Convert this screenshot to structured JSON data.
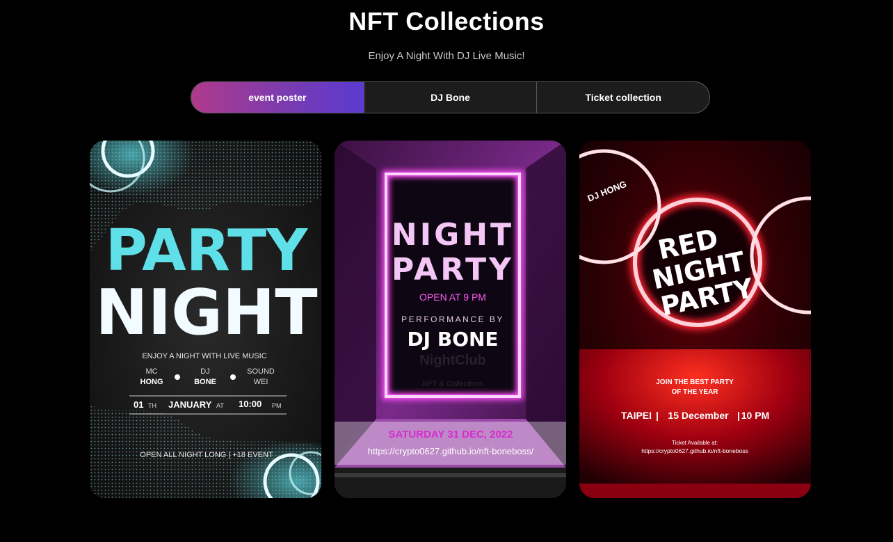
{
  "header": {
    "title": "NFT Collections",
    "subtitle": "Enjoy A Night With DJ Live Music!"
  },
  "tabs": [
    {
      "label": "event poster",
      "active": true
    },
    {
      "label": "DJ Bone",
      "active": false
    },
    {
      "label": "Ticket collection",
      "active": false
    }
  ],
  "colors": {
    "accent_start": "#b03a8c",
    "accent_end": "#5b3ad0",
    "cyan": "#5fe0e8",
    "neon_pink": "#ff4df5",
    "red": "#e01020"
  },
  "posters": [
    {
      "title_line1": "PARTY",
      "title_line2": "NIGHT",
      "tagline": "ENJOY A NIGHT WITH LIVE MUSIC",
      "roles": [
        {
          "role": "MC",
          "name": "HONG"
        },
        {
          "role": "DJ",
          "name": "BONE"
        },
        {
          "role": "SOUND",
          "name": "WEI"
        }
      ],
      "date_day": "01",
      "date_day_suffix": "TH",
      "date_month": "JANUARY",
      "date_at": "AT",
      "time": "10:00",
      "time_suffix": "PM",
      "footer": "OPEN ALL NIGHT LONG | +18 EVENT"
    },
    {
      "title_line1": "NIGHT",
      "title_line2": "PARTY",
      "open_time": "OPEN AT 9 PM",
      "performance_by": "PERFORMANCE BY",
      "performer": "DJ BONE",
      "watermark1": "NightClub",
      "watermark2": "NFT & Collections",
      "date": "SATURDAY 31 DEC, 2022",
      "url": "https://crypto0627.github.io/nft-boneboss/"
    },
    {
      "dj_tag": "DJ HONG",
      "title_line1": "RED",
      "title_line2": "NIGHT",
      "title_line3": "PARTY",
      "join_line1": "JOIN THE BEST PARTY",
      "join_line2": "OF THE YEAR",
      "location": "TAIPEI",
      "date": "15 December",
      "time": "10 PM",
      "ticket_label": "Ticket Available at:",
      "url": "https://crypto0627.github.io/nft-boneboss"
    }
  ]
}
